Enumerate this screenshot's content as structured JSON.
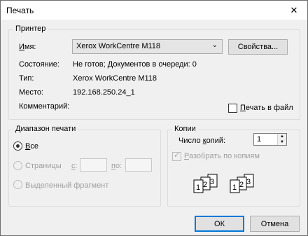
{
  "window": {
    "title": "Печать",
    "close_glyph": "✕"
  },
  "printer": {
    "group_label": "Принтер",
    "name_label": "Имя:",
    "name_value": "Xerox WorkCentre M118",
    "properties_button": "Свойства...",
    "status_label": "Состояние:",
    "status_value": "Не готов; Документов в очереди: 0",
    "type_label": "Тип:",
    "type_value": "Xerox WorkCentre M118",
    "location_label": "Место:",
    "location_value": "192.168.250.24_1",
    "comment_label": "Комментарий:",
    "print_to_file_label": "Печать в файл",
    "print_to_file_checked": false
  },
  "print_range": {
    "group_label": "Диапазон печати",
    "all_label": "Все",
    "pages_label": "Страницы",
    "from_label": "с:",
    "to_label": "по:",
    "selection_label": "Выделенный фрагмент",
    "selected": "all"
  },
  "copies": {
    "group_label": "Копии",
    "count_label": "Число копий:",
    "count_value": "1",
    "collate_label": "Разобрать по копиям",
    "collate_checked": true,
    "collate_digits": [
      "1",
      "2",
      "3"
    ]
  },
  "buttons": {
    "ok": "ОК",
    "cancel": "Отмена"
  }
}
